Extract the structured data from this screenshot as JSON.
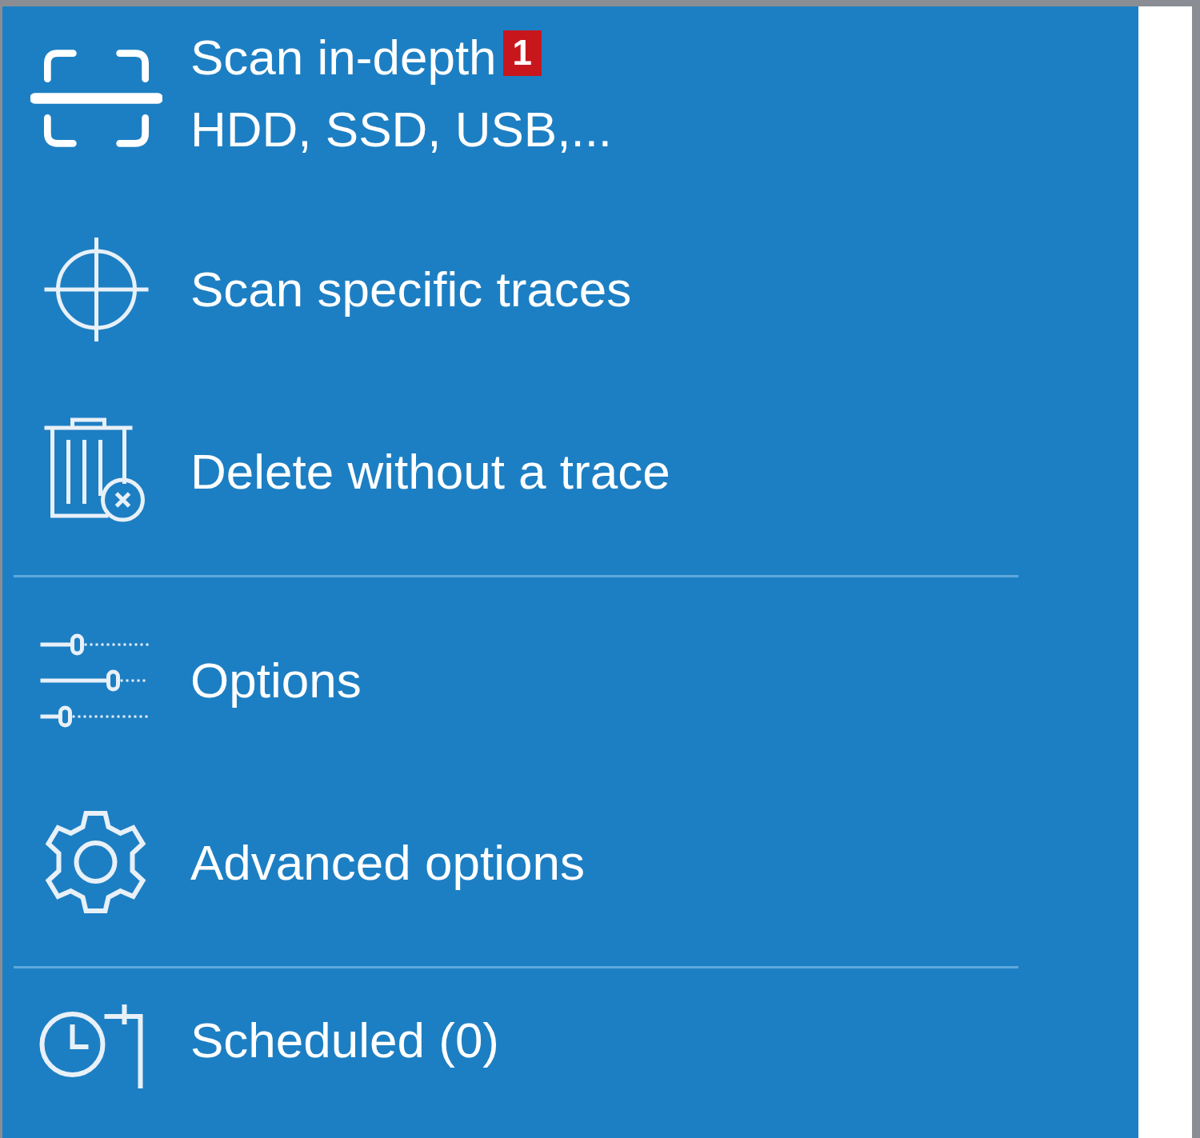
{
  "menu": {
    "groups": [
      {
        "items": [
          {
            "kind": "scan",
            "label": "Scan in-depth",
            "badge": "1",
            "sublabel": "HDD, SSD, USB,..."
          },
          {
            "kind": "crosshair",
            "label": "Scan specific traces"
          },
          {
            "kind": "trash",
            "label": "Delete without a trace"
          }
        ]
      },
      {
        "items": [
          {
            "kind": "sliders",
            "label": "Options"
          },
          {
            "kind": "gear",
            "label": "Advanced options"
          }
        ]
      },
      {
        "items": [
          {
            "kind": "clock",
            "label": "Scheduled (0)"
          }
        ]
      }
    ]
  }
}
